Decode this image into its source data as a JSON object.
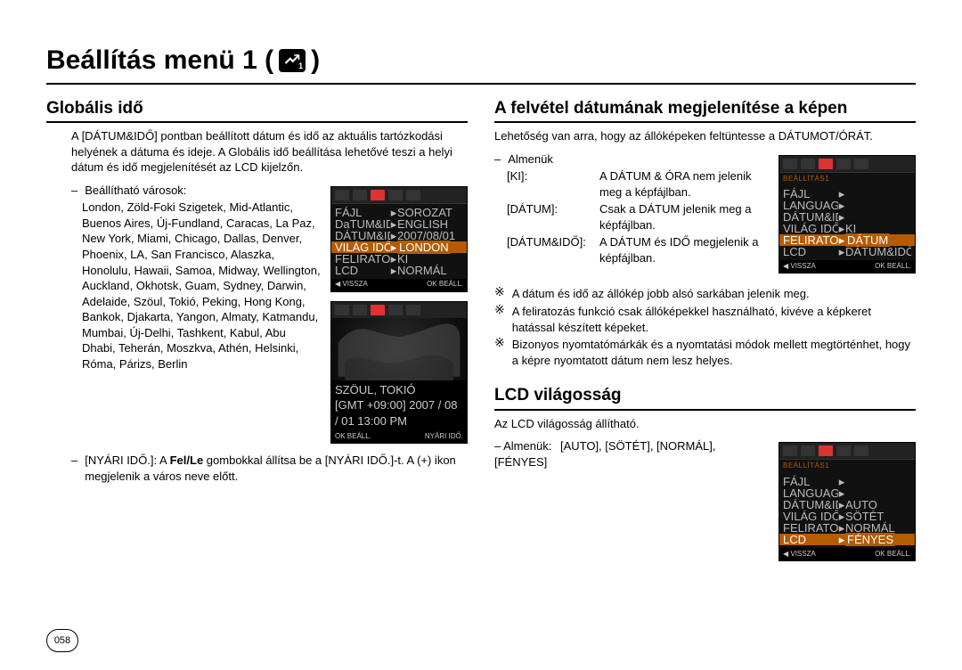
{
  "page_number": "058",
  "title": "Beállítás menü 1 (",
  "title_close": ")",
  "badge_sub": "1",
  "left": {
    "h": "Globális idő",
    "intro": "A [DÁTUM&IDŐ] pontban beállított dátum és idő az aktuális tartózkodási helyének a dátuma és ideje. A Globális idő beállítása lehetővé teszi a helyi dátum és idő megjelenítését az LCD kijelzőn.",
    "cities_label": "Beállítható városok:",
    "cities": "London, Zöld-Foki Szigetek, Mid-Atlantic, Buenos Aires, Új-Fundland, Caracas, La Paz, New York, Miami, Chicago, Dallas, Denver, Phoenix, LA, San Francisco, Alaszka, Honolulu, Hawaii, Samoa, Midway, Wellington, Auckland, Okhotsk, Guam, Sydney, Darwin, Adelaide, Szöul, Tokió, Peking, Hong Kong, Bankok, Djakarta, Yangon, Almaty, Katmandu, Mumbai, Új-Delhi, Tashkent, Kabul, Abu Dhabi, Teherán, Moszkva, Athén, Helsinki, Róma, Párizs, Berlin",
    "dst_line_a": "[NYÁRI IDŐ.]: A ",
    "dst_bold": "Fel/Le",
    "dst_line_b": " gombokkal állítsa be a [NYÁRI IDŐ.]-t. A (+) ikon megjelenik a város neve előtt.",
    "shot1": {
      "rows": [
        {
          "l": "FÁJL",
          "r": "SOROZAT"
        },
        {
          "l": "DaTUM&IDŐ",
          "r": "ENGLISH"
        },
        {
          "l": "DÁTUM&IDŐ",
          "r": "2007/08/01"
        },
        {
          "l": "VILÁG IDŐ",
          "r": "LONDON",
          "sel": true
        },
        {
          "l": "FELIRATOZÁS",
          "r": "KI"
        },
        {
          "l": "LCD",
          "r": "NORMÁL"
        }
      ],
      "foot_l": "◀  VISSZA",
      "foot_r": "OK  BEÁLL."
    },
    "shot2": {
      "city": "SZÖUL, TOKIÓ",
      "gmt": "[GMT +09:00] 2007 / 08 / 01  13:00 PM",
      "foot_l": "OK  BEÁLL.",
      "foot_r": "NYÁRI IDŐ."
    }
  },
  "rightA": {
    "h": "A felvétel dátumának megjelenítése a képen",
    "intro": "Lehetőség van arra, hogy az állóképeken feltüntesse a DÁTUMOT/ÓRÁT.",
    "sub_label": "Almenük",
    "opts": [
      {
        "k": "[KI]:",
        "v": "A DÁTUM & ÓRA nem jelenik meg a képfájlban."
      },
      {
        "k": "[DÁTUM]:",
        "v": "Csak a DÁTUM jelenik meg a képfájlban."
      },
      {
        "k": "[DÁTUM&IDŐ]:",
        "v": "A DÁTUM és IDŐ megjelenik a képfájlban."
      }
    ],
    "notes": [
      "A dátum és idő az állókép jobb alsó sarkában jelenik meg.",
      "A feliratozás funkció csak állóképekkel használható, kivéve a  képkeret hatással készített képeket.",
      "Bizonyos nyomtatómárkák és a nyomtatási módok mellett megtörténhet, hogy a képre nyomtatott dátum nem lesz helyes."
    ],
    "shot": {
      "hdr": "BEÁLLÍTÁS1",
      "rows": [
        {
          "l": "FÁJL",
          "r": ""
        },
        {
          "l": "LANGUAGE",
          "r": ""
        },
        {
          "l": "DÁTUM&IDŐ",
          "r": ""
        },
        {
          "l": "VILÁG IDŐ",
          "r": "KI"
        },
        {
          "l": "FELIRATOZÁS",
          "r": "DÁTUM",
          "sel": true
        },
        {
          "l": "LCD",
          "r": "DÁTUM&IDŐ"
        }
      ],
      "foot_l": "◀  VISSZA",
      "foot_r": "OK  BEÁLL."
    }
  },
  "rightB": {
    "h": "LCD világosság",
    "intro": "Az LCD világosság állítható.",
    "sub_label": "– Almenük:",
    "opts": "[AUTO], [SÖTÉT], [NORMÁL], [FÉNYES]",
    "shot": {
      "hdr": "BEÁLLÍTÁS1",
      "rows": [
        {
          "l": "FÁJL",
          "r": ""
        },
        {
          "l": "LANGUAGE",
          "r": ""
        },
        {
          "l": "DÁTUM&IDŐ",
          "r": "AUTO"
        },
        {
          "l": "VILÁG IDŐ",
          "r": "SÖTÉT"
        },
        {
          "l": "FELIRATOZÁS",
          "r": "NORMÁL"
        },
        {
          "l": "LCD",
          "r": "FÉNYES",
          "sel": true
        }
      ],
      "foot_l": "◀  VISSZA",
      "foot_r": "OK  BEÁLL."
    }
  }
}
